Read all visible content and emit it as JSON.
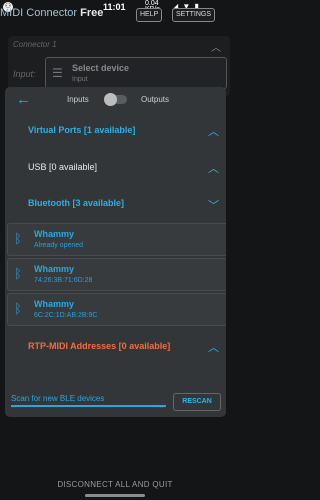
{
  "status": {
    "time": "11:01",
    "data_rate": "0.04\nKB/s",
    "icons": "◢ ▼ ▮"
  },
  "appbar": {
    "title_main": "MIDI Connector ",
    "title_free": "Free",
    "help_label": "HELP",
    "settings_label": "SETTINGS"
  },
  "connector": {
    "label": "Connector 1",
    "input_label": "Input:",
    "select_title": "Select device",
    "select_sub": "Input"
  },
  "dialog": {
    "inputs_label": "Inputs",
    "outputs_label": "Outputs",
    "sections": {
      "virtual": "Virtual Ports [1 available]",
      "usb": "USB [0 available]",
      "bluetooth": "Bluetooth [3 available]",
      "rtp": "RTP-MIDI Addresses [0 available]"
    },
    "devices": [
      {
        "name": "Whammy",
        "sub": "Already opened"
      },
      {
        "name": "Whammy",
        "sub": "74:26:3B:71:6D:28"
      },
      {
        "name": "Whammy",
        "sub": "6C:2C:1D:AB:2B:9C"
      }
    ],
    "scan_text": "Scan for new BLE devices",
    "rescan_label": "RESCAN"
  },
  "footer": {
    "disconnect_label": "DISCONNECT ALL AND QUIT"
  },
  "colors": {
    "accent": "#2bb0e4",
    "rtp_accent": "#f16d3e",
    "dialog_bg": "#333638",
    "page_bg": "#141516"
  },
  "icons": {
    "back": "arrow-left-icon",
    "bluetooth": "bluetooth-icon",
    "chevron_up": "chevron-up-icon",
    "chevron_down": "chevron-down-icon"
  }
}
